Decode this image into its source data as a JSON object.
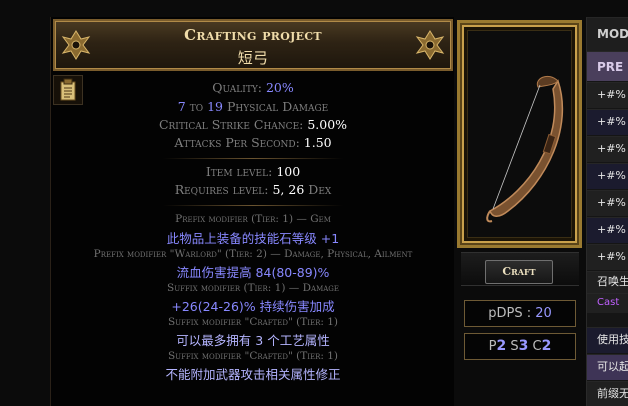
{
  "tooltip": {
    "name": "Crafting project",
    "base": "短弓",
    "quality_label": "Quality:",
    "quality_value": "20%",
    "damage_min": "7",
    "damage_to": "to",
    "damage_max": "19",
    "damage_label": "Physical Damage",
    "crit_label": "Critical Strike Chance:",
    "crit_value": "5.00%",
    "aps_label": "Attacks Per Second:",
    "aps_value": "1.50",
    "ilvl_label": "Item level:",
    "ilvl_value": "100",
    "req_label": "Requires level:",
    "req_level": "5,",
    "req_dex": "26",
    "req_dex_label": "Dex",
    "mods": [
      {
        "header": "Prefix modifier (Tier: 1) — Gem",
        "text": "此物品上装备的技能石等级 +1"
      },
      {
        "header": "Prefix modifier \"Warlord\" (Tier: 2) — Damage, Physical, Ailment",
        "text": "流血伤害提高 84(80-89)%"
      },
      {
        "header": "Suffix modifier (Tier: 1) — Damage",
        "text": "+26(24-26)% 持续伤害加成"
      },
      {
        "header": "Suffix modifier \"Crafted\" (Tier: 1)",
        "text": "可以最多拥有 3 个工艺属性"
      },
      {
        "header": "Suffix modifier \"Crafted\" (Tier: 1)",
        "text": "不能附加武器攻击相关属性修正"
      }
    ]
  },
  "craft_label": "Craft",
  "pdps_label": "pDPS :",
  "pdps_value": "20",
  "prefix_label": "P",
  "prefix_count": "2",
  "suffix_label": "S",
  "suffix_count": "3",
  "crafted_label": "C",
  "crafted_count": "2",
  "mod_panel": {
    "header": "MOD",
    "prefix_tab": "PRE",
    "rows": [
      "+#% ",
      "+#% ",
      "+#% ",
      "+#% ",
      "+#% ",
      "+#% ",
      "+#% ",
      "召唤生",
      "使用技",
      "可以起",
      "前缀无"
    ],
    "row_sub": "Cast"
  },
  "colors": {
    "magic": "#8888ff",
    "crafted": "#b4b4ff",
    "gold": "#f0dcaa",
    "frame": "#9a7a30"
  },
  "icons": [
    "clipboard-icon",
    "bow-icon",
    "header-wing-icon"
  ]
}
